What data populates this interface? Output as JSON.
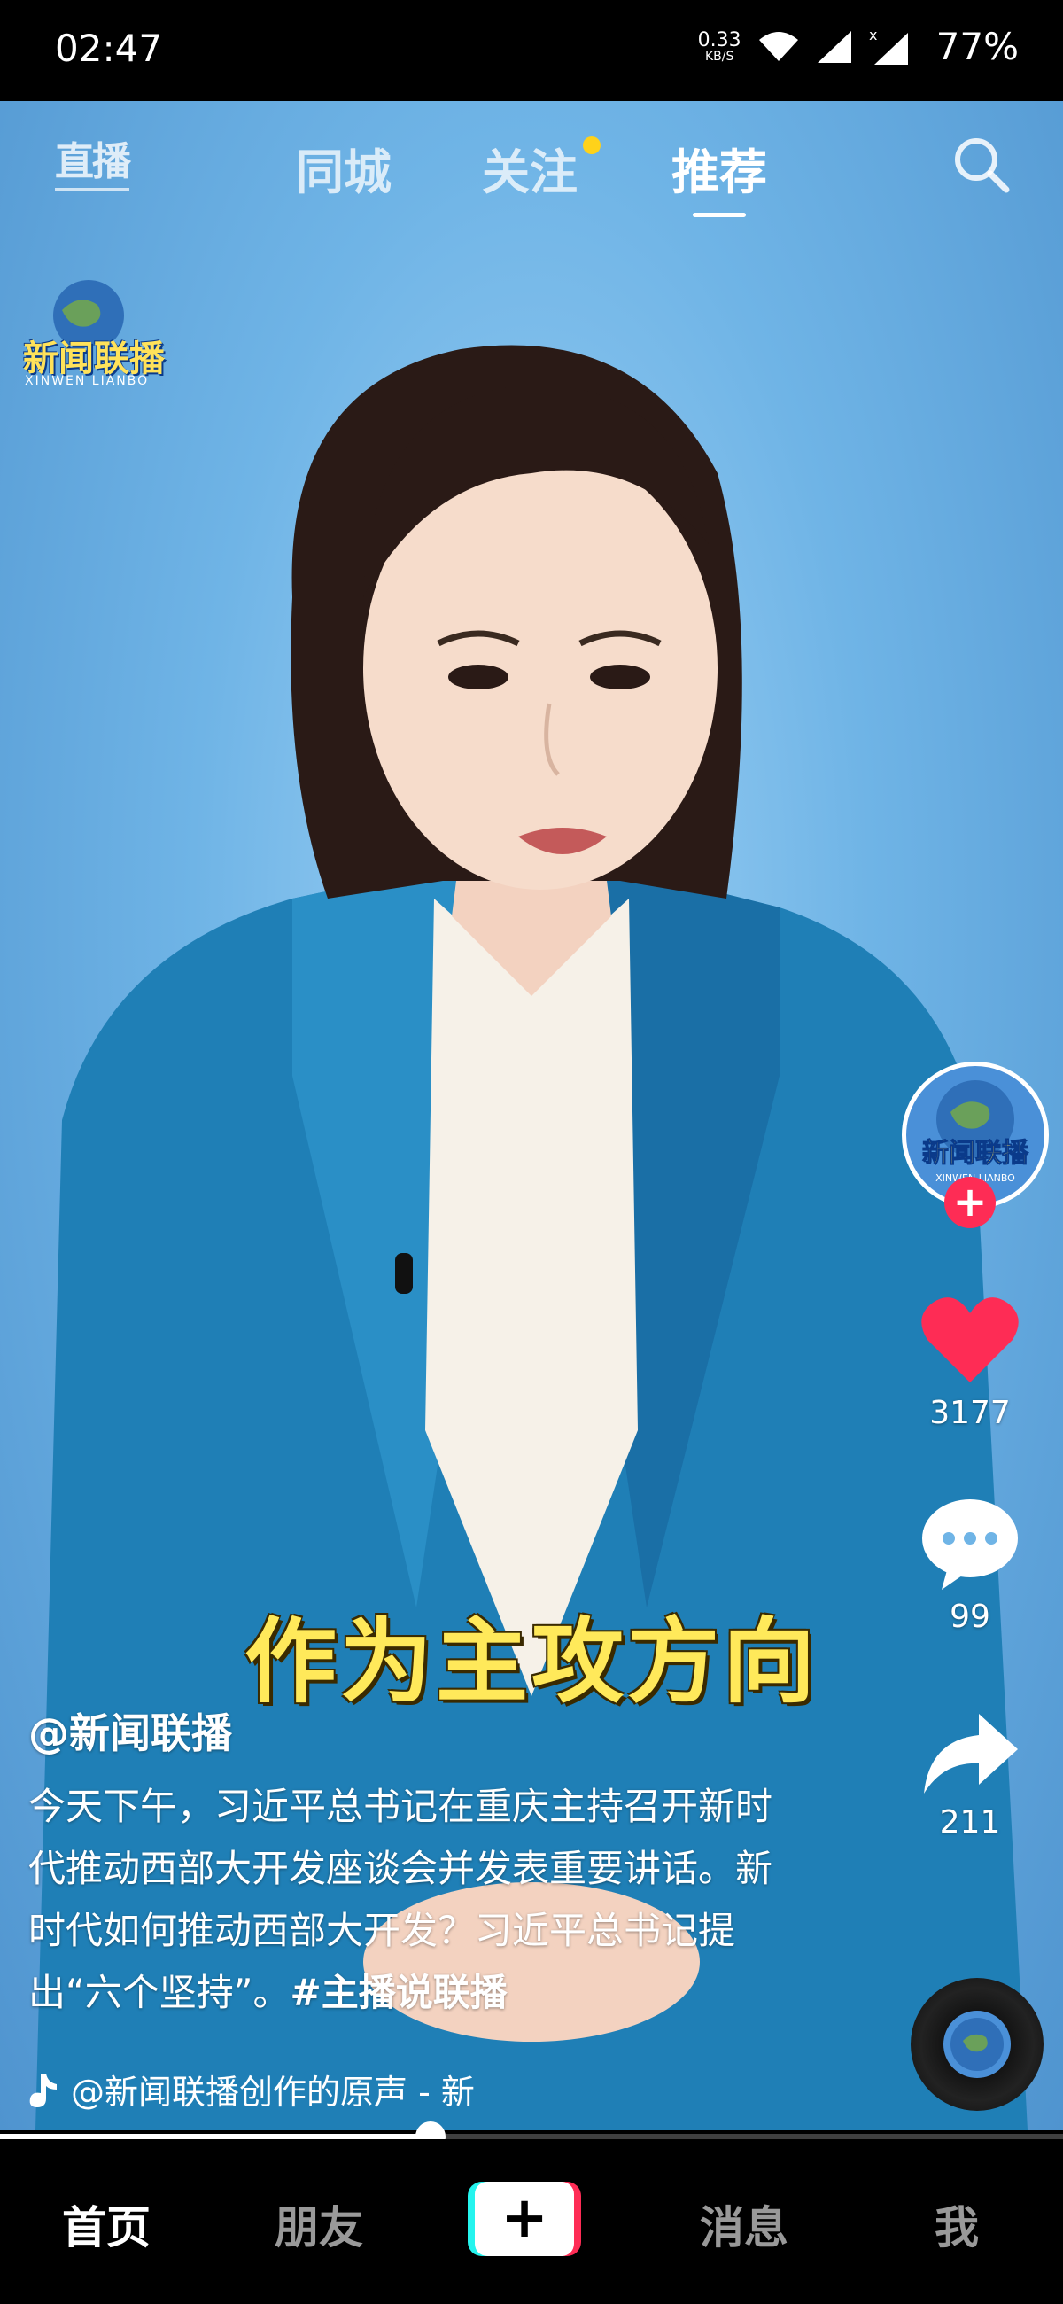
{
  "status_bar": {
    "time": "02:47",
    "net_speed_value": "0.33",
    "net_speed_unit": "KB/S",
    "battery": "77%"
  },
  "top_nav": {
    "live_label": "直播",
    "tabs": [
      {
        "label": "同城",
        "active": false
      },
      {
        "label": "关注",
        "active": false,
        "has_dot": true
      },
      {
        "label": "推荐",
        "active": true
      }
    ]
  },
  "video": {
    "logo_text": "新闻联播",
    "logo_sub": "XINWEN LIANBO",
    "subtitle": "作为主攻方向"
  },
  "rail": {
    "likes": "3177",
    "comments": "99",
    "shares": "211"
  },
  "caption": {
    "author": "@新闻联播",
    "description": "今天下午，习近平总书记在重庆主持召开新时代推动西部大开发座谈会并发表重要讲话。新时代如何推动西部大开发？习近平总书记提出“六个坚持”。",
    "hashtag": "#主播说联播",
    "music": "@新闻联播创作的原声 - 新"
  },
  "progress": {
    "fraction": 0.405
  },
  "bottom_nav": {
    "home": "首页",
    "friends": "朋友",
    "messages": "消息",
    "me": "我"
  },
  "colors": {
    "accent_red": "#fe2c55",
    "accent_cyan": "#25f4ee",
    "follow_dot": "#ffd21a",
    "subtitle": "#ffe95a",
    "background": "#6fb4e6"
  }
}
